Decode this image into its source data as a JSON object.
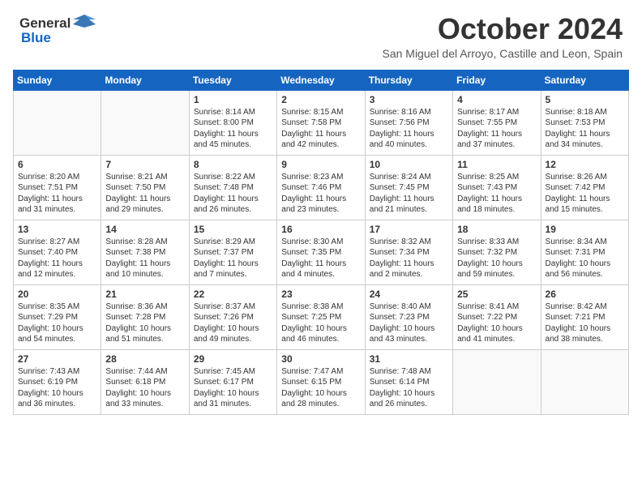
{
  "header": {
    "logo_general": "General",
    "logo_blue": "Blue",
    "month_title": "October 2024",
    "subtitle": "San Miguel del Arroyo, Castille and Leon, Spain"
  },
  "calendar": {
    "days_of_week": [
      "Sunday",
      "Monday",
      "Tuesday",
      "Wednesday",
      "Thursday",
      "Friday",
      "Saturday"
    ],
    "weeks": [
      [
        {
          "day": "",
          "info": ""
        },
        {
          "day": "",
          "info": ""
        },
        {
          "day": "1",
          "info": "Sunrise: 8:14 AM\nSunset: 8:00 PM\nDaylight: 11 hours and 45 minutes."
        },
        {
          "day": "2",
          "info": "Sunrise: 8:15 AM\nSunset: 7:58 PM\nDaylight: 11 hours and 42 minutes."
        },
        {
          "day": "3",
          "info": "Sunrise: 8:16 AM\nSunset: 7:56 PM\nDaylight: 11 hours and 40 minutes."
        },
        {
          "day": "4",
          "info": "Sunrise: 8:17 AM\nSunset: 7:55 PM\nDaylight: 11 hours and 37 minutes."
        },
        {
          "day": "5",
          "info": "Sunrise: 8:18 AM\nSunset: 7:53 PM\nDaylight: 11 hours and 34 minutes."
        }
      ],
      [
        {
          "day": "6",
          "info": "Sunrise: 8:20 AM\nSunset: 7:51 PM\nDaylight: 11 hours and 31 minutes."
        },
        {
          "day": "7",
          "info": "Sunrise: 8:21 AM\nSunset: 7:50 PM\nDaylight: 11 hours and 29 minutes."
        },
        {
          "day": "8",
          "info": "Sunrise: 8:22 AM\nSunset: 7:48 PM\nDaylight: 11 hours and 26 minutes."
        },
        {
          "day": "9",
          "info": "Sunrise: 8:23 AM\nSunset: 7:46 PM\nDaylight: 11 hours and 23 minutes."
        },
        {
          "day": "10",
          "info": "Sunrise: 8:24 AM\nSunset: 7:45 PM\nDaylight: 11 hours and 21 minutes."
        },
        {
          "day": "11",
          "info": "Sunrise: 8:25 AM\nSunset: 7:43 PM\nDaylight: 11 hours and 18 minutes."
        },
        {
          "day": "12",
          "info": "Sunrise: 8:26 AM\nSunset: 7:42 PM\nDaylight: 11 hours and 15 minutes."
        }
      ],
      [
        {
          "day": "13",
          "info": "Sunrise: 8:27 AM\nSunset: 7:40 PM\nDaylight: 11 hours and 12 minutes."
        },
        {
          "day": "14",
          "info": "Sunrise: 8:28 AM\nSunset: 7:38 PM\nDaylight: 11 hours and 10 minutes."
        },
        {
          "day": "15",
          "info": "Sunrise: 8:29 AM\nSunset: 7:37 PM\nDaylight: 11 hours and 7 minutes."
        },
        {
          "day": "16",
          "info": "Sunrise: 8:30 AM\nSunset: 7:35 PM\nDaylight: 11 hours and 4 minutes."
        },
        {
          "day": "17",
          "info": "Sunrise: 8:32 AM\nSunset: 7:34 PM\nDaylight: 11 hours and 2 minutes."
        },
        {
          "day": "18",
          "info": "Sunrise: 8:33 AM\nSunset: 7:32 PM\nDaylight: 10 hours and 59 minutes."
        },
        {
          "day": "19",
          "info": "Sunrise: 8:34 AM\nSunset: 7:31 PM\nDaylight: 10 hours and 56 minutes."
        }
      ],
      [
        {
          "day": "20",
          "info": "Sunrise: 8:35 AM\nSunset: 7:29 PM\nDaylight: 10 hours and 54 minutes."
        },
        {
          "day": "21",
          "info": "Sunrise: 8:36 AM\nSunset: 7:28 PM\nDaylight: 10 hours and 51 minutes."
        },
        {
          "day": "22",
          "info": "Sunrise: 8:37 AM\nSunset: 7:26 PM\nDaylight: 10 hours and 49 minutes."
        },
        {
          "day": "23",
          "info": "Sunrise: 8:38 AM\nSunset: 7:25 PM\nDaylight: 10 hours and 46 minutes."
        },
        {
          "day": "24",
          "info": "Sunrise: 8:40 AM\nSunset: 7:23 PM\nDaylight: 10 hours and 43 minutes."
        },
        {
          "day": "25",
          "info": "Sunrise: 8:41 AM\nSunset: 7:22 PM\nDaylight: 10 hours and 41 minutes."
        },
        {
          "day": "26",
          "info": "Sunrise: 8:42 AM\nSunset: 7:21 PM\nDaylight: 10 hours and 38 minutes."
        }
      ],
      [
        {
          "day": "27",
          "info": "Sunrise: 7:43 AM\nSunset: 6:19 PM\nDaylight: 10 hours and 36 minutes."
        },
        {
          "day": "28",
          "info": "Sunrise: 7:44 AM\nSunset: 6:18 PM\nDaylight: 10 hours and 33 minutes."
        },
        {
          "day": "29",
          "info": "Sunrise: 7:45 AM\nSunset: 6:17 PM\nDaylight: 10 hours and 31 minutes."
        },
        {
          "day": "30",
          "info": "Sunrise: 7:47 AM\nSunset: 6:15 PM\nDaylight: 10 hours and 28 minutes."
        },
        {
          "day": "31",
          "info": "Sunrise: 7:48 AM\nSunset: 6:14 PM\nDaylight: 10 hours and 26 minutes."
        },
        {
          "day": "",
          "info": ""
        },
        {
          "day": "",
          "info": ""
        }
      ]
    ]
  }
}
